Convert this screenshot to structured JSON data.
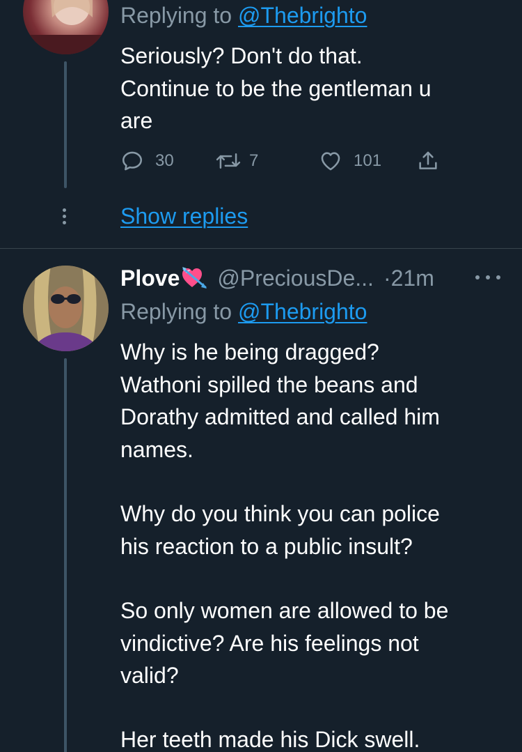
{
  "tweet1": {
    "replying_prefix": "Replying to ",
    "replying_handle": "@Thebrighto",
    "text": "Seriously? Don't do that.\nContinue to be the gentleman u\nare",
    "replies_count": "30",
    "retweets_count": "7",
    "likes_count": "101",
    "show_replies": "Show replies"
  },
  "tweet2": {
    "name": "Plove",
    "emoji": "💘",
    "handle": "@PreciousDe...",
    "separator": "·",
    "time": "21m",
    "replying_prefix": "Replying to ",
    "replying_handle": "@Thebrighto",
    "paragraphs": [
      "Why is he being dragged?\nWathoni spilled the beans and\nDorathy admitted and called him\nnames.",
      "Why do you think you can police\nhis reaction to a public insult?",
      "So only women are allowed to be\nvindictive? Are his feelings not\nvalid?",
      "Her teeth made his Dick swell."
    ]
  },
  "colors": {
    "background": "#15202b",
    "text_primary": "#ffffff",
    "text_secondary": "#8899a6",
    "link": "#1d9bf0",
    "thread_line": "#3d5466",
    "divider": "#38444d"
  },
  "icons": [
    "reply-icon",
    "retweet-icon",
    "like-icon",
    "share-icon",
    "more-options-icon",
    "thread-options-icon",
    "heart-arrow-emoji"
  ]
}
